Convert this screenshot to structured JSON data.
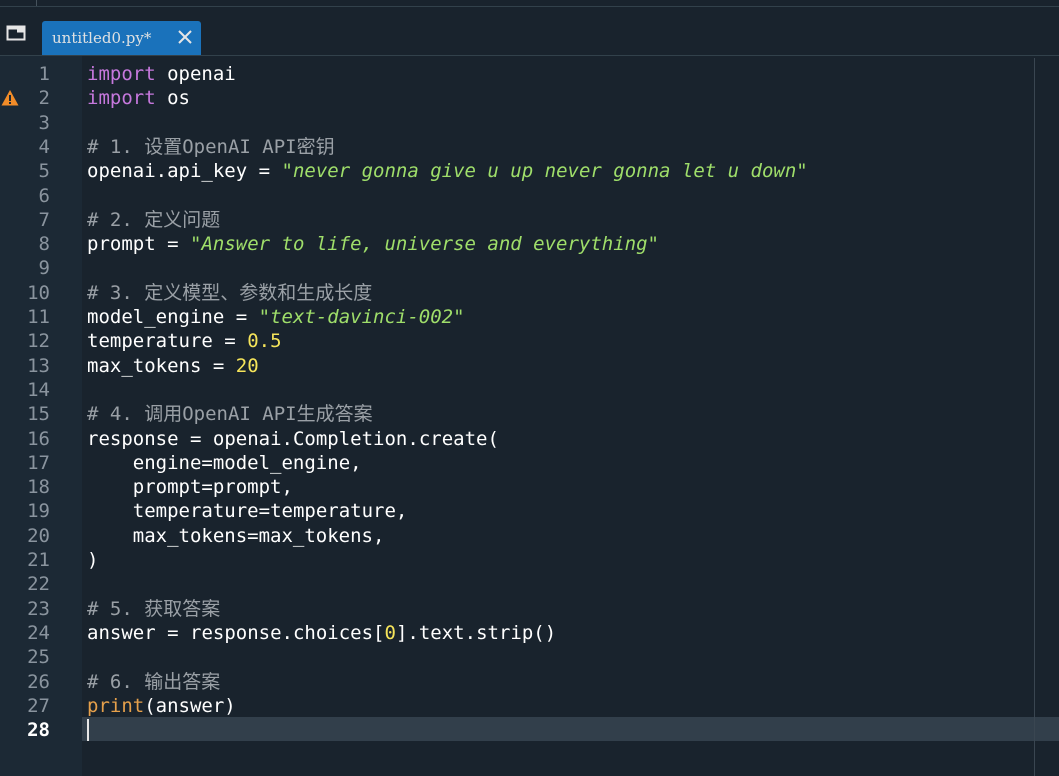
{
  "tab": {
    "label": "untitled0.py*"
  },
  "icons": {
    "browse_tabs": "browse-tabs-icon",
    "close_tab": "close-icon",
    "warning": "warning-icon"
  },
  "colors": {
    "background": "#19232d",
    "gutter": "#1c2935",
    "tab_active": "#1a72bb",
    "keyword": "#c678dd",
    "builtin": "#e5a04b",
    "number": "#f5e45a",
    "string": "#9fde6a",
    "comment": "#9aa0a6",
    "warning": "#f28c28"
  },
  "editor": {
    "current_line": 28,
    "warning_line": 2,
    "lines": [
      "import openai",
      "import os",
      "",
      "# 1. 设置OpenAI API密钥",
      "openai.api_key = \"never gonna give u up never gonna let u down\"",
      "",
      "# 2. 定义问题",
      "prompt = \"Answer to life, universe and everything\"",
      "",
      "# 3. 定义模型、参数和生成长度",
      "model_engine = \"text-davinci-002\"",
      "temperature = 0.5",
      "max_tokens = 20",
      "",
      "# 4. 调用OpenAI API生成答案",
      "response = openai.Completion.create(",
      "    engine=model_engine,",
      "    prompt=prompt,",
      "    temperature=temperature,",
      "    max_tokens=max_tokens,",
      ")",
      "",
      "# 5. 获取答案",
      "answer = response.choices[0].text.strip()",
      "",
      "# 6. 输出答案",
      "print(answer)",
      ""
    ]
  }
}
